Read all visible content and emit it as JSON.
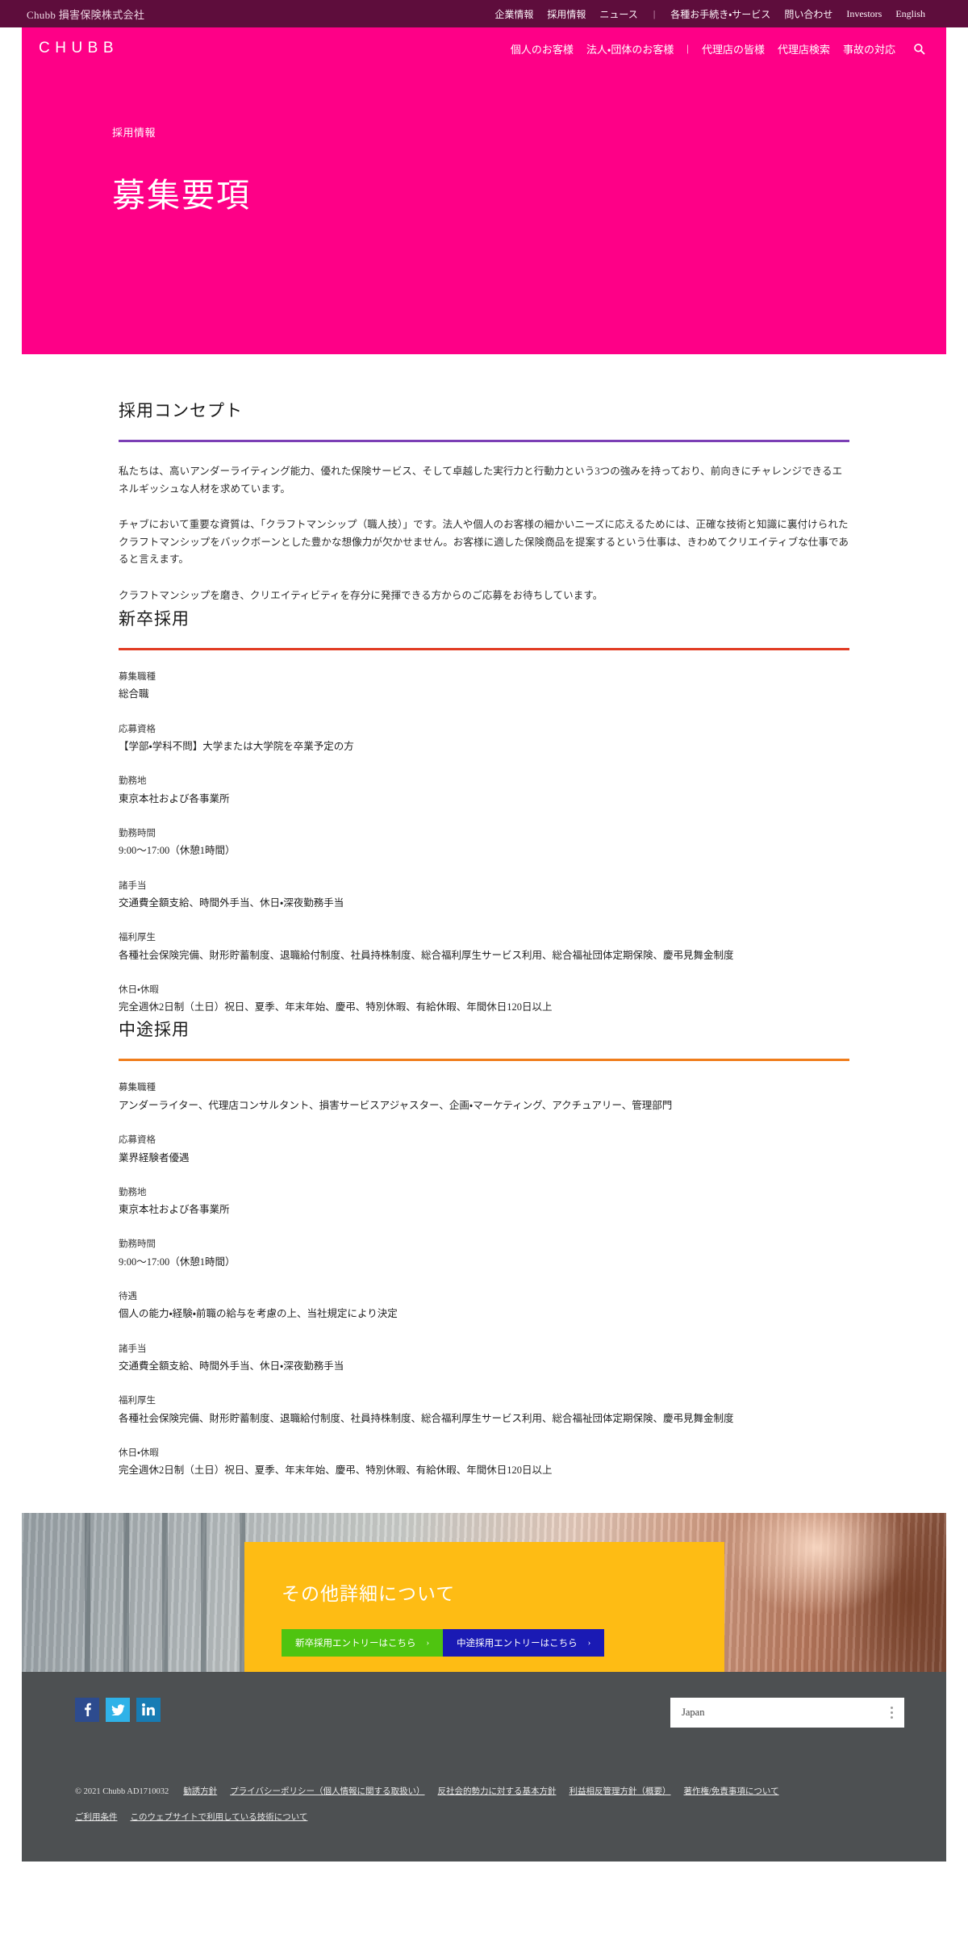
{
  "colors": {
    "brand_magenta": "#fe0087",
    "utility_maroon": "#5e0d3c",
    "rule_purple": "#7b3fb5",
    "rule_red": "#e13b23",
    "rule_orange": "#f07d1b",
    "cta_yellow": "#febc14",
    "cta_green": "#4fc410",
    "cta_blue": "#1a1ab4",
    "footer_gray": "#4d5052"
  },
  "utility": {
    "corp_name": "Chubb 損害保険株式会社",
    "links": [
      {
        "label": "企業情報"
      },
      {
        "label": "採用情報"
      },
      {
        "label": "ニュース"
      },
      {
        "separator": "|"
      },
      {
        "label": "各種お手続き・サービス"
      },
      {
        "label": "問い合わせ"
      },
      {
        "label": "Investors"
      },
      {
        "label": "English"
      }
    ]
  },
  "brand": {
    "logo": "CHUBB",
    "nav": [
      {
        "label": "個人のお客様"
      },
      {
        "label": "法人・団体のお客様"
      },
      {
        "separator": "|"
      },
      {
        "label": "代理店の皆様"
      },
      {
        "label": "代理店検索"
      },
      {
        "label": "事故の対応"
      }
    ],
    "search_icon": "search-icon"
  },
  "hero": {
    "breadcrumb": "採用情報",
    "title": "募集要項"
  },
  "concept": {
    "title": "採用コンセプト",
    "rule_color": "#7b3fb5",
    "paragraphs": [
      "私たちは、高いアンダーライティング能力、優れた保険サービス、そして卓越した実行力と行動力という3つの強みを持っており、前向きにチャレンジできるエネルギッシュな人材を求めています。",
      "チャブにおいて重要な資質は、「クラフトマンシップ（職人技）」です。法人や個人のお客様の細かいニーズに応えるためには、正確な技術と知識に裏付けられたクラフトマンシップをバックボーンとした豊かな想像力が欠かせません。お客様に適した保険商品を提案するという仕事は、きわめてクリエイティブな仕事であると言えます。",
      "クラフトマンシップを磨き、クリエイティビティを存分に発揮できる方からのご応募をお待ちしています。"
    ]
  },
  "new_grad": {
    "title": "新卒採用",
    "rule_color": "#e13b23",
    "fields": [
      {
        "label": "募集職種",
        "value": "総合職"
      },
      {
        "label": "応募資格",
        "value": "【学部・学科不問】大学または大学院を卒業予定の方"
      },
      {
        "label": "勤務地",
        "value": "東京本社および各事業所"
      },
      {
        "label": "勤務時間",
        "value": "9:00～17:00（休憩1時間）"
      },
      {
        "label": "諸手当",
        "value": "交通費全額支給、時間外手当、休日・深夜勤務手当"
      },
      {
        "label": "福利厚生",
        "value": "各種社会保険完備、財形貯蓄制度、退職給付制度、社員持株制度、総合福利厚生サービス利用、総合福祉団体定期保険、慶弔見舞金制度"
      },
      {
        "label": "休日・休暇",
        "value": "完全週休2日制（土日）祝日、夏季、年末年始、慶弔、特別休暇、有給休暇、年間休日120日以上"
      }
    ]
  },
  "mid_career": {
    "title": "中途採用",
    "rule_color": "#f07d1b",
    "fields": [
      {
        "label": "募集職種",
        "value": "アンダーライター、代理店コンサルタント、損害サービスアジャスター、企画・マーケティング、アクチュアリー、管理部門"
      },
      {
        "label": "応募資格",
        "value": "業界経験者優遇"
      },
      {
        "label": "勤務地",
        "value": "東京本社および各事業所"
      },
      {
        "label": "勤務時間",
        "value": "9:00～17:00（休憩1時間）"
      },
      {
        "label": "待遇",
        "value": "個人の能力・経験・前職の給与を考慮の上、当社規定により決定"
      },
      {
        "label": "諸手当",
        "value": "交通費全額支給、時間外手当、休日・深夜勤務手当"
      },
      {
        "label": "福利厚生",
        "value": "各種社会保険完備、財形貯蓄制度、退職給付制度、社員持株制度、総合福利厚生サービス利用、総合福祉団体定期保険、慶弔見舞金制度"
      },
      {
        "label": "休日・休暇",
        "value": "完全週休2日制（土日）祝日、夏季、年末年始、慶弔、特別休暇、有給休暇、年間休日120日以上"
      }
    ]
  },
  "cta": {
    "heading": "その他詳細について",
    "buttons": [
      {
        "label": "新卒採用エントリーはこちら",
        "chevron": "›",
        "style": "green"
      },
      {
        "label": "中途採用エントリーはこちら",
        "chevron": "›",
        "style": "blue"
      }
    ]
  },
  "footer": {
    "social": [
      {
        "name": "facebook-icon",
        "glyph": "f"
      },
      {
        "name": "twitter-icon",
        "glyph": "t"
      },
      {
        "name": "linkedin-icon",
        "glyph": "in"
      }
    ],
    "country_selected": "Japan",
    "copyright": "© 2021 Chubb AD1710032",
    "links_row1": [
      {
        "label": "勧誘方針"
      },
      {
        "label": "プライバシーポリシー（個人情報に関する取扱い）"
      },
      {
        "label": "反社会的勢力に対する基本方針"
      },
      {
        "label": "利益相反管理方針（概要）"
      },
      {
        "label": "著作権/免責事項について"
      }
    ],
    "links_row2": [
      {
        "label": "ご利用条件"
      },
      {
        "label": "このウェブサイトで利用している技術について"
      }
    ]
  }
}
